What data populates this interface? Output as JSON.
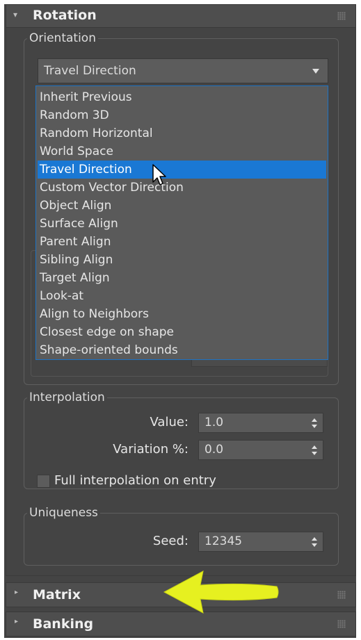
{
  "rotation": {
    "title": "Rotation",
    "orientation": {
      "label": "Orientation",
      "selected": "Travel Direction",
      "options": [
        "Inherit Previous",
        "Random 3D",
        "Random Horizontal",
        "World Space",
        "Travel Direction",
        "Custom Vector Direction",
        "Object Align",
        "Surface Align",
        "Parent Align",
        "Sibling Align",
        "Target Align",
        "Look-at",
        "Align to Neighbors",
        "Closest edge on shape",
        "Shape-oriented bounds"
      ],
      "highlighted_index": 4
    },
    "interpolation": {
      "label": "Interpolation",
      "value_label": "Value:",
      "value": "1.0",
      "variation_label": "Variation %:",
      "variation": "0.0",
      "full_interp_label": "Full interpolation on entry",
      "full_interp_checked": false
    },
    "uniqueness": {
      "label": "Uniqueness",
      "seed_label": "Seed:",
      "seed": "12345"
    }
  },
  "matrix": {
    "title": "Matrix"
  },
  "banking": {
    "title": "Banking"
  },
  "colors": {
    "panel_bg": "#444444",
    "header_bg": "#4e4e4e",
    "selection": "#1a78d4",
    "annotation_arrow": "#e6f020"
  }
}
